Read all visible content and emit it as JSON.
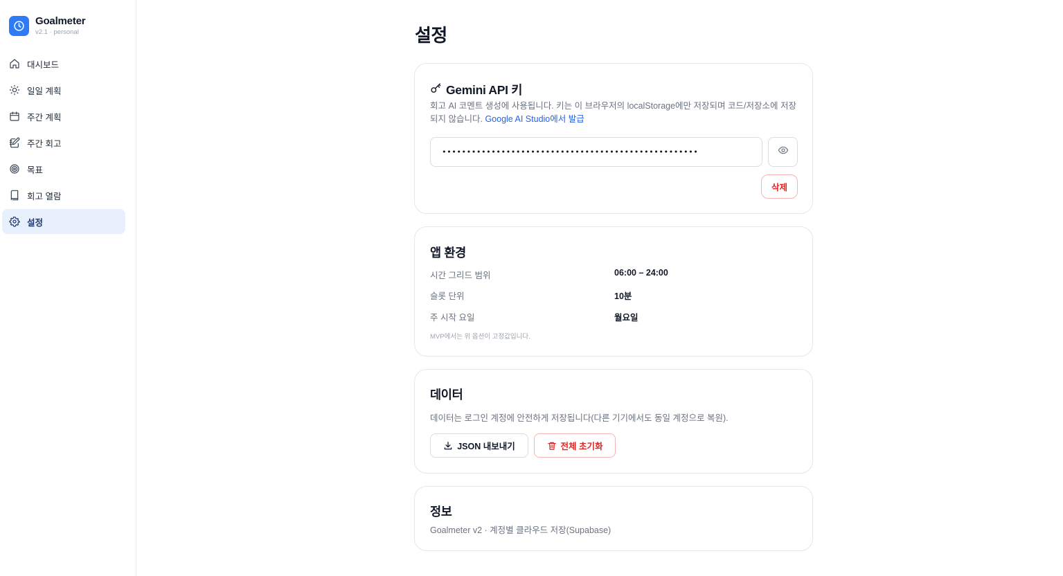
{
  "app": {
    "name": "Goalmeter",
    "version": "v2.1 · personal",
    "accent_color": "#2f7bf5"
  },
  "sidebar": {
    "items": [
      {
        "label": "대시보드",
        "icon": "home-icon",
        "active": false
      },
      {
        "label": "일일 계획",
        "icon": "sun-icon",
        "active": false
      },
      {
        "label": "주간 계획",
        "icon": "calendar-icon",
        "active": false
      },
      {
        "label": "주간 회고",
        "icon": "notebook-pen-icon",
        "active": false
      },
      {
        "label": "목표",
        "icon": "target-icon",
        "active": false
      },
      {
        "label": "회고 열람",
        "icon": "book-icon",
        "active": false
      },
      {
        "label": "설정",
        "icon": "gear-icon",
        "active": true
      }
    ]
  },
  "page": {
    "title": "설정"
  },
  "gemini": {
    "title": "Gemini API 키",
    "icon": "key-icon",
    "description": "회고 AI 코멘트 생성에 사용됩니다. 키는 이 브라우저의 localStorage에만 저장되며 코드/저장소에 저장되지 않습니다.",
    "link_label": "Google AI Studio에서 발급",
    "key_value": "••••••••••••••••••••••••••••••••••••••••••••••••••••",
    "toggle_icon": "eye-icon",
    "delete_label": "삭제"
  },
  "environment": {
    "title": "앱 환경",
    "rows": [
      {
        "label": "시간 그리드 범위",
        "value": "06:00 – 24:00"
      },
      {
        "label": "슬롯 단위",
        "value": "10분"
      },
      {
        "label": "주 시작 요일",
        "value": "월요일"
      }
    ],
    "note": "MVP에서는 위 옵션이 고정값입니다."
  },
  "data_section": {
    "title": "데이터",
    "description": "데이터는 로그인 계정에 안전하게 저장됩니다(다른 기기에서도 동일 계정으로 복원).",
    "export_label": "JSON 내보내기",
    "export_icon": "download-icon",
    "reset_label": "전체 초기화",
    "reset_icon": "trash-icon",
    "danger_color": "#dc2626"
  },
  "info": {
    "title": "정보",
    "description": "Goalmeter v2 · 계정별 클라우드 저장(Supabase)"
  }
}
